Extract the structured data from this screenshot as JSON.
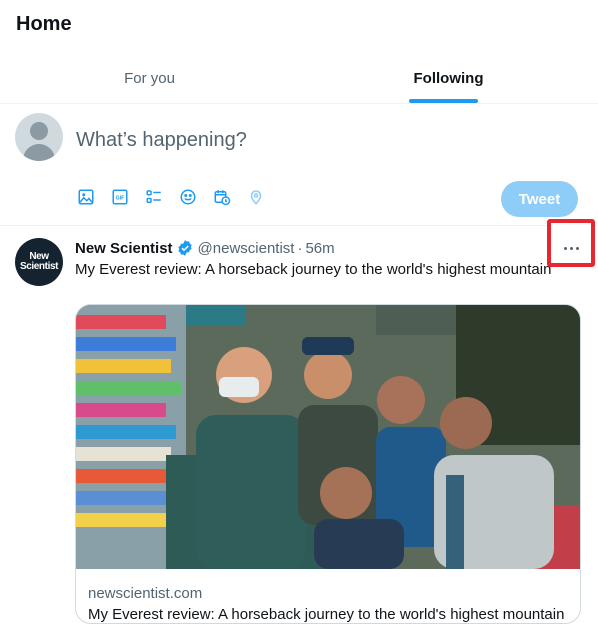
{
  "header": {
    "title": "Home",
    "tabs": [
      {
        "label": "For you",
        "active": false
      },
      {
        "label": "Following",
        "active": true
      }
    ]
  },
  "compose": {
    "placeholder": "What’s happening?",
    "toolbar_icons": [
      "image-icon",
      "gif-icon",
      "poll-icon",
      "emoji-icon",
      "schedule-icon",
      "location-icon"
    ],
    "tweet_label": "Tweet"
  },
  "tweet": {
    "author_name": "New Scientist",
    "avatar_text_line1": "New",
    "avatar_text_line2": "Scientist",
    "handle": "@newscientist",
    "separator": "·",
    "time": "56m",
    "text": "My Everest review: A horseback journey to the world's highest mountain",
    "card": {
      "domain": "newscientist.com",
      "title": "My Everest review: A horseback journey to the world's highest mountain"
    }
  },
  "colors": {
    "accent": "#1d9bf0",
    "tweet_button_disabled": "#8ecdf8",
    "highlight": "#e8262e",
    "secondary_text": "#536471"
  }
}
